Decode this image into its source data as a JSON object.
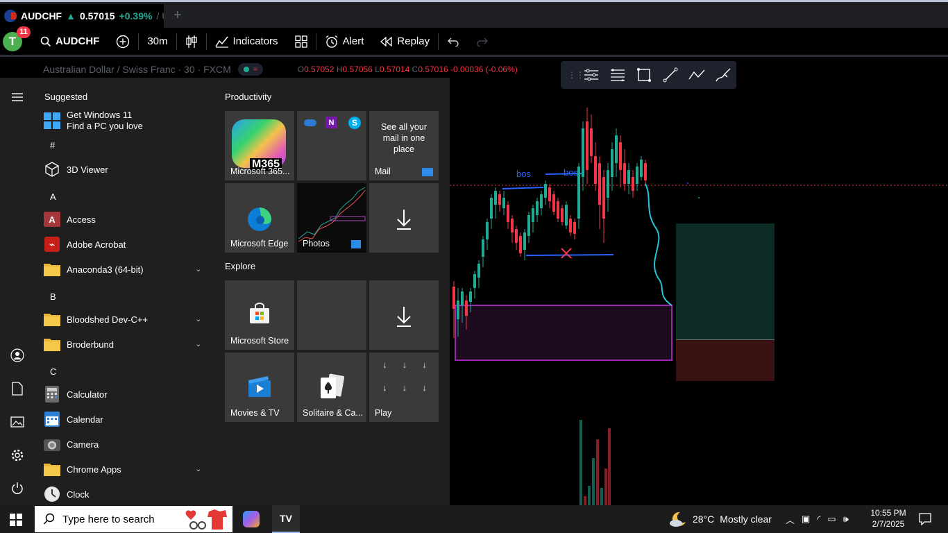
{
  "tab": {
    "symbol": "AUDCHF",
    "arrow": "▲",
    "price": "0.57015",
    "change": "+0.39%",
    "rest": "/ Unn"
  },
  "toolbar": {
    "avatar_letter": "T",
    "notif_count": "11",
    "symbol": "AUDCHF",
    "interval": "30m",
    "indicators": "Indicators",
    "alert": "Alert",
    "replay": "Replay"
  },
  "chart_header": {
    "title": "Australian Dollar / Swiss Franc · 30 · FXCM",
    "o_label": "O",
    "o": "0.57052",
    "h_label": "H",
    "h": "0.57056",
    "l_label": "L",
    "l": "0.57014",
    "c_label": "C",
    "c": "0.57016",
    "chg": "-0.00036 (-0.06%)"
  },
  "start_menu": {
    "suggested_label": "Suggested",
    "suggested_title": "Get Windows 11",
    "suggested_sub": "Find a PC you love",
    "groups": {
      "hash": "#",
      "a": "A",
      "b": "B",
      "c": "C"
    },
    "apps": {
      "viewer3d": "3D Viewer",
      "access": "Access",
      "acrobat": "Adobe Acrobat",
      "anaconda": "Anaconda3 (64-bit)",
      "bloodshed": "Bloodshed Dev-C++",
      "broderbund": "Broderbund",
      "calculator": "Calculator",
      "calendar": "Calendar",
      "camera": "Camera",
      "chrome_apps": "Chrome Apps",
      "clock": "Clock"
    },
    "productivity_label": "Productivity",
    "explore_label": "Explore",
    "tiles": {
      "m365_badge": "M365",
      "m365": "Microsoft 365...",
      "mail_text": "See all your mail in one place",
      "mail": "Mail",
      "edge": "Microsoft Edge",
      "photos": "Photos",
      "store": "Microsoft Store",
      "movies": "Movies & TV",
      "solitaire": "Solitaire & Ca...",
      "play": "Play"
    }
  },
  "chart": {
    "bos1": "bos",
    "bos2": "bos"
  },
  "taskbar": {
    "search_placeholder": "Type here to search",
    "temperature": "28°C",
    "weather": "Mostly clear",
    "time": "10:55 PM",
    "date": "2/7/2025"
  },
  "colors": {
    "up": "#22ab94",
    "down": "#f23645",
    "accent_blue": "#2962ff",
    "zone_purple": "#9c27b0"
  }
}
